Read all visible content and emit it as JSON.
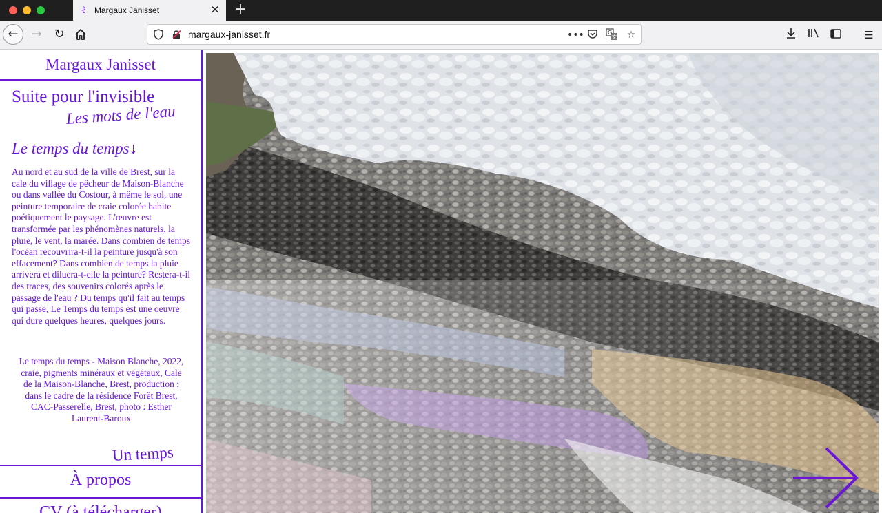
{
  "browser": {
    "tab_title": "Margaux Janisset",
    "tab_favicon": "ℓ",
    "url": "margaux-janisset.fr",
    "icons": [
      "back-icon",
      "forward-icon",
      "reload-icon",
      "home-icon",
      "shield-icon",
      "insecure-lock-icon",
      "more-icon",
      "pocket-icon",
      "translate-icon",
      "star-icon",
      "download-icon",
      "library-icon",
      "sidebar-icon",
      "menu-icon",
      "close-icon",
      "new-tab-icon"
    ]
  },
  "site": {
    "title": "Margaux Janisset",
    "accent_color": "#6a16d8",
    "projects": [
      {
        "label": "Suite pour l'invisible"
      },
      {
        "label": "Les mots de l'eau"
      },
      {
        "label": "Le temps du temps↓"
      },
      {
        "label": "Un temps"
      }
    ],
    "description": "Au nord et au sud de la ville de Brest, sur la cale du village de pêcheur de Maison-Blanche ou dans vallée du Costour, à même le sol, une peinture temporaire de craie colorée habite poétiquement le paysage. L'œuvre est transformée par les phénomènes naturels, la pluie, le vent, la marée. Dans combien de temps l'océan recouvrira-t-il la peinture jusqu'à son effacement? Dans combien de temps la pluie arrivera et diluera-t-elle la peinture? Restera-t-il des traces, des souvenirs colorés après le passage de l'eau ? Du temps qu'il fait au temps qui passe, Le Temps du temps est une oeuvre qui dure quelques heures, quelques jours.",
    "caption": "Le temps du temps - Maison Blanche, 2022, craie, pigments minéraux et végétaux, Cale de la Maison-Blanche, Brest, production : dans le cadre de la résidence Forêt Brest, CAC-Passerelle, Brest, photo : Esther Laurent-Baroux",
    "about": "À propos",
    "cv": "CV (à télécharger)"
  }
}
